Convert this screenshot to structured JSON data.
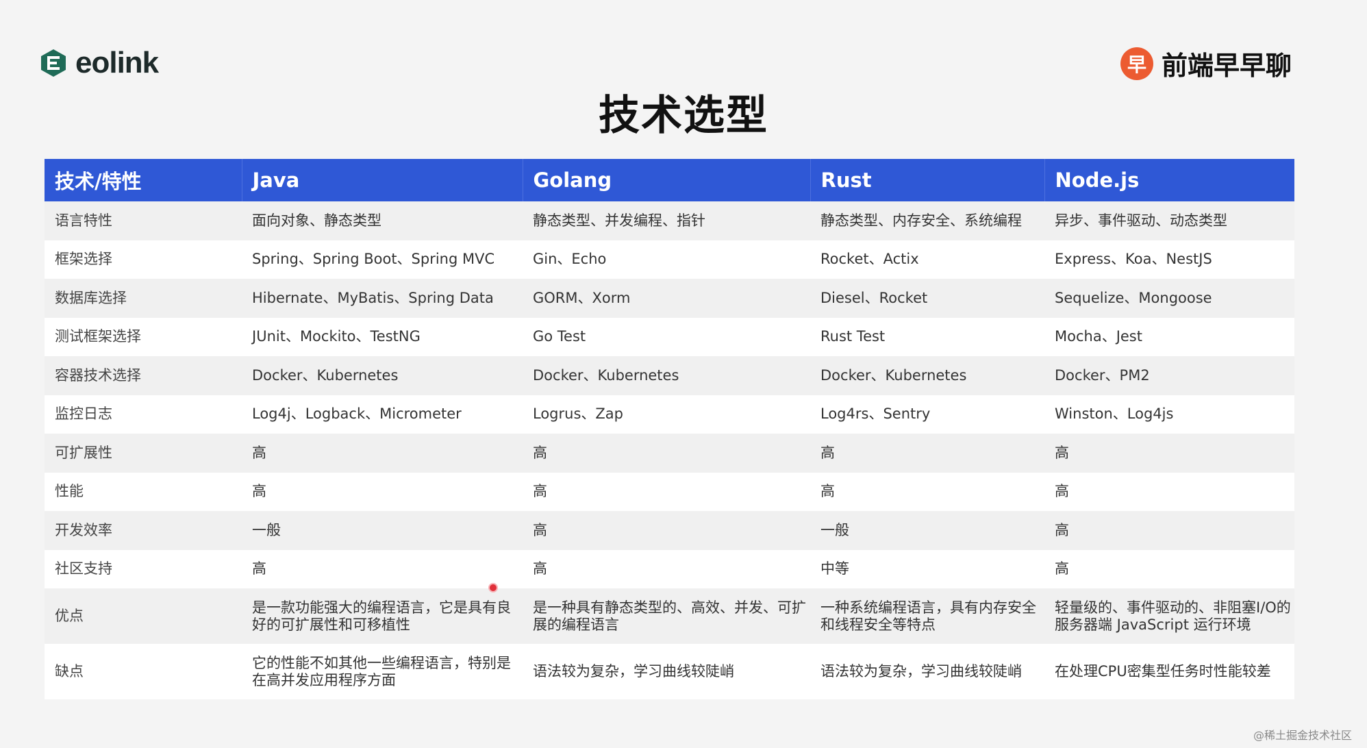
{
  "logo_left": {
    "text": "eolink"
  },
  "logo_right": {
    "badge": "早",
    "text": "前端早早聊"
  },
  "title": "技术选型",
  "table": {
    "headers": [
      "技术/特性",
      "Java",
      "Golang",
      "Rust",
      "Node.js"
    ],
    "rows": [
      [
        "语言特性",
        "面向对象、静态类型",
        "静态类型、并发编程、指针",
        "静态类型、内存安全、系统编程",
        "异步、事件驱动、动态类型"
      ],
      [
        "框架选择",
        "Spring、Spring Boot、Spring MVC",
        "Gin、Echo",
        "Rocket、Actix",
        "Express、Koa、NestJS"
      ],
      [
        "数据库选择",
        "Hibernate、MyBatis、Spring Data",
        "GORM、Xorm",
        "Diesel、Rocket",
        "Sequelize、Mongoose"
      ],
      [
        "测试框架选择",
        "JUnit、Mockito、TestNG",
        "Go Test",
        "Rust Test",
        "Mocha、Jest"
      ],
      [
        "容器技术选择",
        "Docker、Kubernetes",
        "Docker、Kubernetes",
        "Docker、Kubernetes",
        "Docker、PM2"
      ],
      [
        "监控日志",
        "Log4j、Logback、Micrometer",
        "Logrus、Zap",
        "Log4rs、Sentry",
        "Winston、Log4js"
      ],
      [
        "可扩展性",
        "高",
        "高",
        "高",
        "高"
      ],
      [
        "性能",
        "高",
        "高",
        "高",
        "高"
      ],
      [
        "开发效率",
        "一般",
        "高",
        "一般",
        "高"
      ],
      [
        "社区支持",
        "高",
        "高",
        "中等",
        "高"
      ],
      [
        "优点",
        "是一款功能强大的编程语言，它是具有良好的可扩展性和可移植性",
        "是一种具有静态类型的、高效、并发、可扩展的编程语言",
        "一种系统编程语言，具有内存安全和线程安全等特点",
        "轻量级的、事件驱动的、非阻塞I/O的服务器端 JavaScript 运行环境"
      ],
      [
        "缺点",
        "它的性能不如其他一些编程语言，特别是在高并发应用程序方面",
        "语法较为复杂，学习曲线较陡峭",
        "语法较为复杂，学习曲线较陡峭",
        "在处理CPU密集型任务时性能较差"
      ]
    ]
  },
  "watermark": "@稀土掘金技术社区",
  "colors": {
    "header_bg": "#2f58d6",
    "logo_green": "#1f6b57",
    "brand_orange": "#ec5b31"
  }
}
